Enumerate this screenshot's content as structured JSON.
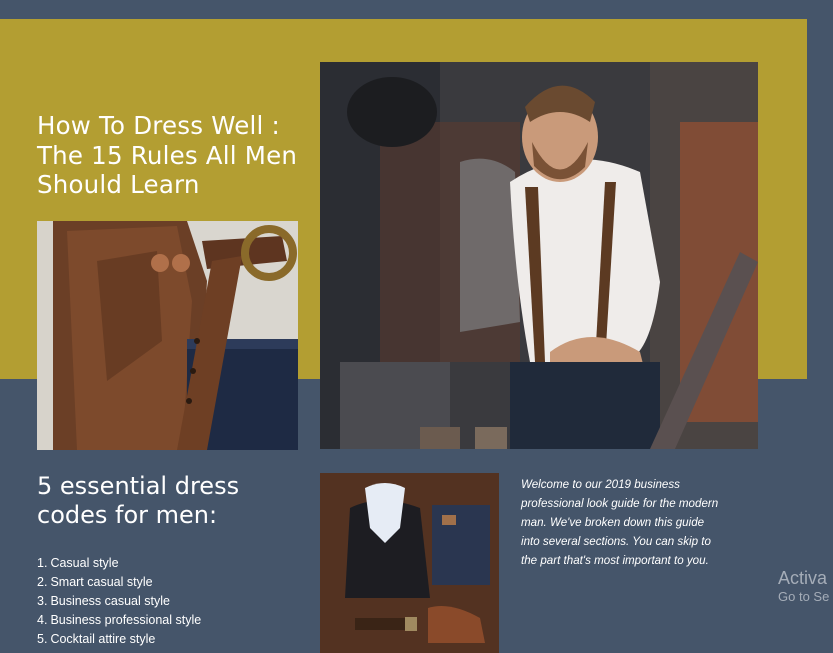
{
  "hero": {
    "title": "How To Dress Well : The 15 Rules All Men Should Learn"
  },
  "images": {
    "belt": "leather-belt-apron-photo",
    "tailor": "tailor-man-suspenders-photo",
    "outfit": "flat-lay-outfit-photo"
  },
  "codes": {
    "heading": "5 essential dress codes for men:",
    "items": [
      {
        "num": "1.",
        "label": "Casual style"
      },
      {
        "num": "2.",
        "label": "Smart casual style"
      },
      {
        "num": "3.",
        "label": "Business casual style"
      },
      {
        "num": "4.",
        "label": "Business professional style"
      },
      {
        "num": "5.",
        "label": "Cocktail attire style"
      }
    ]
  },
  "intro": {
    "text": "Welcome to our 2019 business professional look guide for the modern man. We've broken down this guide into several sections. You can skip to the part that's most important to you."
  },
  "watermark": {
    "line1": "Activa",
    "line2": "Go to Se"
  },
  "colors": {
    "background": "#45556a",
    "gold_panel": "#b39e32",
    "text": "#ffffff"
  }
}
